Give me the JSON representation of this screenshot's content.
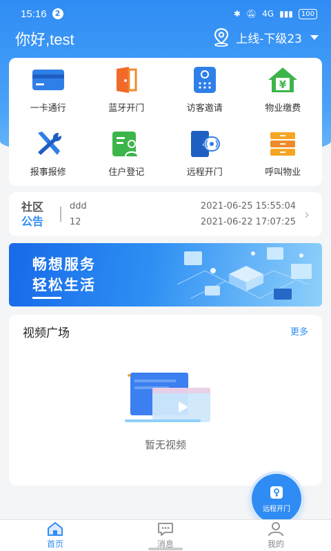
{
  "status_bar": {
    "time": "15:16",
    "notification_count": "2",
    "network": "4G",
    "battery": "100"
  },
  "header": {
    "greeting": "你好,test",
    "location": "上线-下级23"
  },
  "grid": {
    "items": [
      {
        "label": "一卡通行",
        "icon": "card-icon"
      },
      {
        "label": "蓝牙开门",
        "icon": "bluetooth-door-icon"
      },
      {
        "label": "访客邀请",
        "icon": "visitor-intercom-icon"
      },
      {
        "label": "物业缴费",
        "icon": "house-payment-icon"
      },
      {
        "label": "报事报修",
        "icon": "repair-tools-icon"
      },
      {
        "label": "住户登记",
        "icon": "resident-register-icon"
      },
      {
        "label": "远程开门",
        "icon": "remote-door-icon"
      },
      {
        "label": "呼叫物业",
        "icon": "call-property-icon"
      }
    ]
  },
  "notice": {
    "logo_line1": "社区",
    "logo_line2": "公告",
    "rows": [
      {
        "title": "ddd",
        "date": "2021-06-25 15:55:04"
      },
      {
        "title": "12",
        "date": "2021-06-22 17:07:25"
      }
    ]
  },
  "banner": {
    "line1": "畅想服务",
    "line2": "轻松生活"
  },
  "video": {
    "title": "视频广场",
    "more": "更多",
    "empty": "暂无视频"
  },
  "fab": {
    "label": "远程开门"
  },
  "tabbar": {
    "tabs": [
      {
        "label": "首页",
        "active": true
      },
      {
        "label": "消息",
        "active": false
      },
      {
        "label": "我的",
        "active": false
      }
    ]
  },
  "colors": {
    "primary": "#2f8cf4",
    "orange": "#f08a2c",
    "green": "#3cb54a"
  }
}
